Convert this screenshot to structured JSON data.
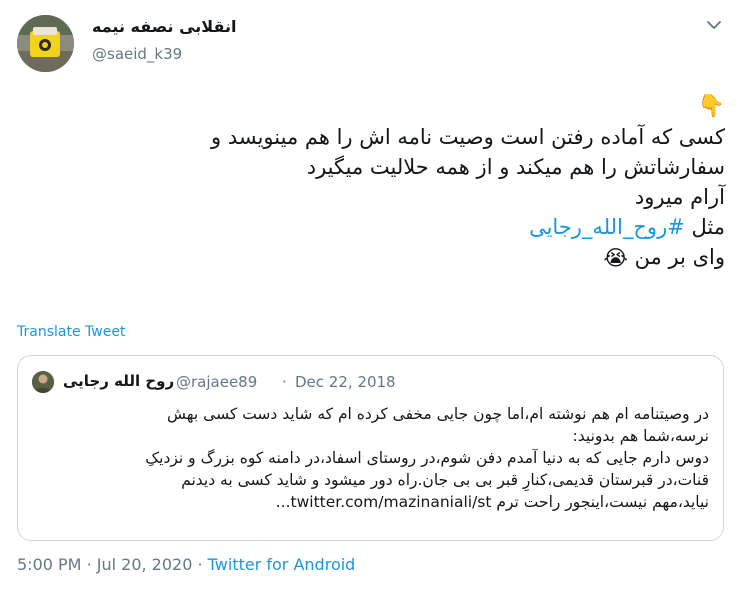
{
  "author": {
    "name": "انقلابی نصفه نیمه",
    "handle": "@saeid_k39"
  },
  "tweet": {
    "emoji_top": "👇",
    "line1": "کسی که آماده رفتن است وصیت نامه اش را هم مینویسد و",
    "line2": "سفارشاتش را هم میکند و از همه حلالیت میگیرد",
    "line3": "آرام میرود",
    "line4_prefix": "مثل",
    "hashtag": "#روح_الله_رجایی",
    "line5": "وای بر من",
    "emoji_end": "😭"
  },
  "translate_label": "Translate Tweet",
  "quoted": {
    "name": "روح الله رجایی",
    "handle": "@rajaee89",
    "separator": "·",
    "date": "Dec 22, 2018",
    "lines": [
      "در وصیتنامه ام هم نوشته ام،اما چون جایی مخفی کرده ام که شاید دست کسی بهش",
      "نرسه،شما هم بدونید:",
      "دوس دارم جایی که به دنیا آمدم دفن شوم،در روستای اسفاد،در دامنه کوه بزرگ و نزدیکِ",
      "قنات،در قبرستان قدیمی،کنارِ قبر بی بی جان.راه دور میشود و شاید کسی به دیدنم",
      "نیاید،مهم نیست،اینجور راحت ترم twitter.com/mazinaniali/st..."
    ]
  },
  "meta": {
    "time": "5:00 PM",
    "dot": "·",
    "date": "Jul 20, 2020",
    "source": "Twitter for Android"
  },
  "colors": {
    "link": "#1b95e0",
    "muted": "#657786",
    "border": "#ccd6dd",
    "text": "#14171a"
  },
  "icons": {
    "more": "chevron-down-icon"
  }
}
